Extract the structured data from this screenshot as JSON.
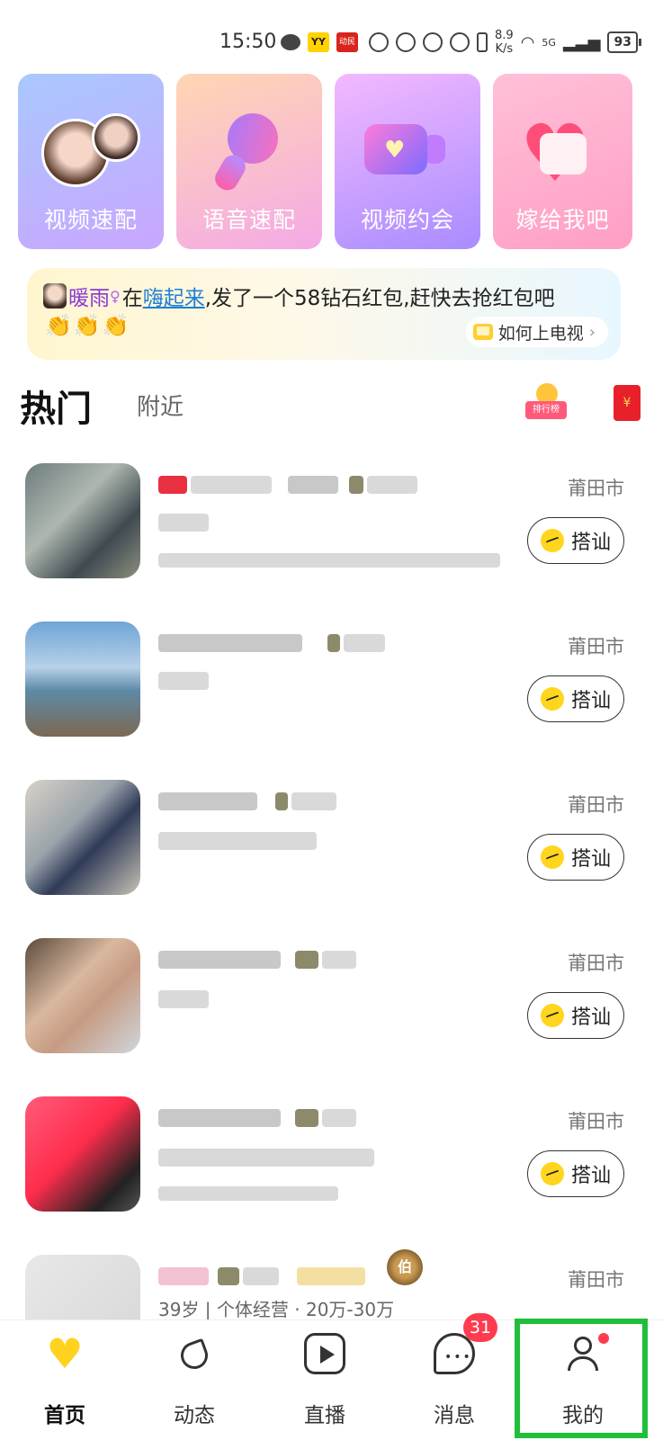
{
  "status_bar": {
    "time": "15:50",
    "yy_label": "YY",
    "news_label": "动民",
    "net_speed_value": "8.9",
    "net_speed_unit": "K/s",
    "network": "5G",
    "battery": "93"
  },
  "feature_cards": [
    {
      "label": "视频速配",
      "icon": "couple-faces-icon"
    },
    {
      "label": "语音速配",
      "icon": "microphone-icon"
    },
    {
      "label": "视频约会",
      "icon": "video-camera-heart-icon"
    },
    {
      "label": "嫁给我吧",
      "icon": "wedding-heart-icon"
    }
  ],
  "notice": {
    "user_name": "暖雨",
    "text_in": "在",
    "room_name": "嗨起来",
    "text_rest": ",发了一个58钻石红包,赶快去抢红包吧",
    "claps": "👏👏👏",
    "tv_button": "如何上电视"
  },
  "tabs": {
    "hot": "热门",
    "nearby": "附近",
    "rank_label": "排行榜",
    "redpacket_symbol": "¥"
  },
  "users": [
    {
      "city": "莆田市",
      "action": "搭讪"
    },
    {
      "city": "莆田市",
      "action": "搭讪"
    },
    {
      "city": "莆田市",
      "action": "搭讪"
    },
    {
      "city": "莆田市",
      "action": "搭讪"
    },
    {
      "city": "莆田市",
      "action": "搭讪"
    },
    {
      "city": "莆田市",
      "info": "39岁 | 个体经营 · 20万-30万",
      "level": "伯"
    }
  ],
  "bottom_nav": {
    "home": "首页",
    "moments": "动态",
    "live": "直播",
    "messages": "消息",
    "messages_badge": "31",
    "me": "我的"
  },
  "colors": {
    "accent_yellow": "#ffd21f",
    "badge_red": "#ff3b4f",
    "link_blue": "#1d7fd6",
    "highlight_green": "#1fbf3a"
  }
}
